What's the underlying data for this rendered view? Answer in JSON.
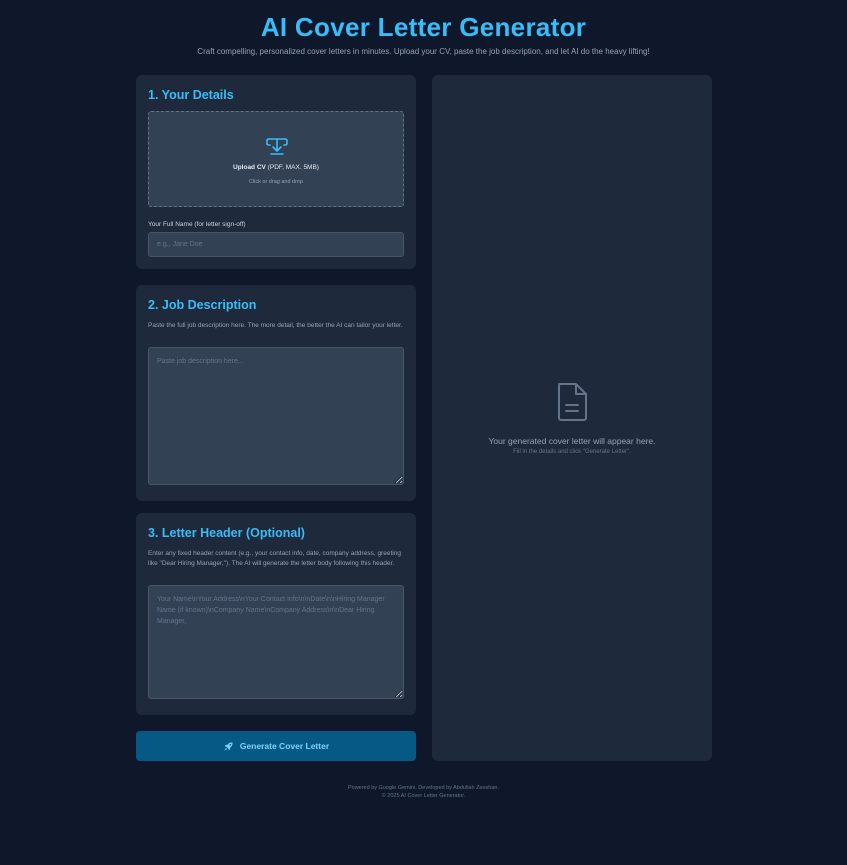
{
  "header": {
    "title": "AI Cover Letter Generator",
    "subtitle": "Craft compelling, personalized cover letters in minutes. Upload your CV, paste the job description, and let AI do the heavy lifting!"
  },
  "details": {
    "title": "1. Your Details",
    "upload_label": "Upload CV",
    "upload_formats": "(PDF, MAX. 5MB)",
    "upload_hint": "Click or drag and drop",
    "name_label": "Your Full Name (for letter sign-off)",
    "name_value": "",
    "name_placeholder": "e.g., Jane Doe"
  },
  "job": {
    "title": "2. Job Description",
    "description": "Paste the full job description here. The more detail, the better the AI can tailor your letter.",
    "value": "",
    "placeholder": "Paste job description here..."
  },
  "letter_header": {
    "title": "3. Letter Header (Optional)",
    "description": "Enter any fixed header content (e.g., your contact info, date, company address, greeting like \"Dear Hiring Manager,\"). The AI will generate the letter body following this header.",
    "value": "",
    "placeholder": "Your Name\\nYour Address\\nYour Contact Info\\n\\nDate\\n\\nHiring Manager Name (if known)\\nCompany Name\\nCompany Address\\n\\nDear Hiring Manager,"
  },
  "actions": {
    "generate_label": "Generate Cover Letter"
  },
  "output": {
    "placeholder": "Your generated cover letter will appear here.",
    "hint": "Fill in the details and click \"Generate Letter\"."
  },
  "footer": {
    "line1": "Powered by Google Gemini. Developed by Abdullah Zeeshan.",
    "line2": "© 2025 AI Cover Letter Generator."
  },
  "icons": {
    "upload": "upload-icon",
    "rocket": "rocket-icon",
    "document": "document-icon"
  },
  "colors": {
    "background": "#0f172a",
    "card": "#1e293b",
    "accent": "#38bdf8",
    "button": "#075985",
    "input": "#334155"
  }
}
